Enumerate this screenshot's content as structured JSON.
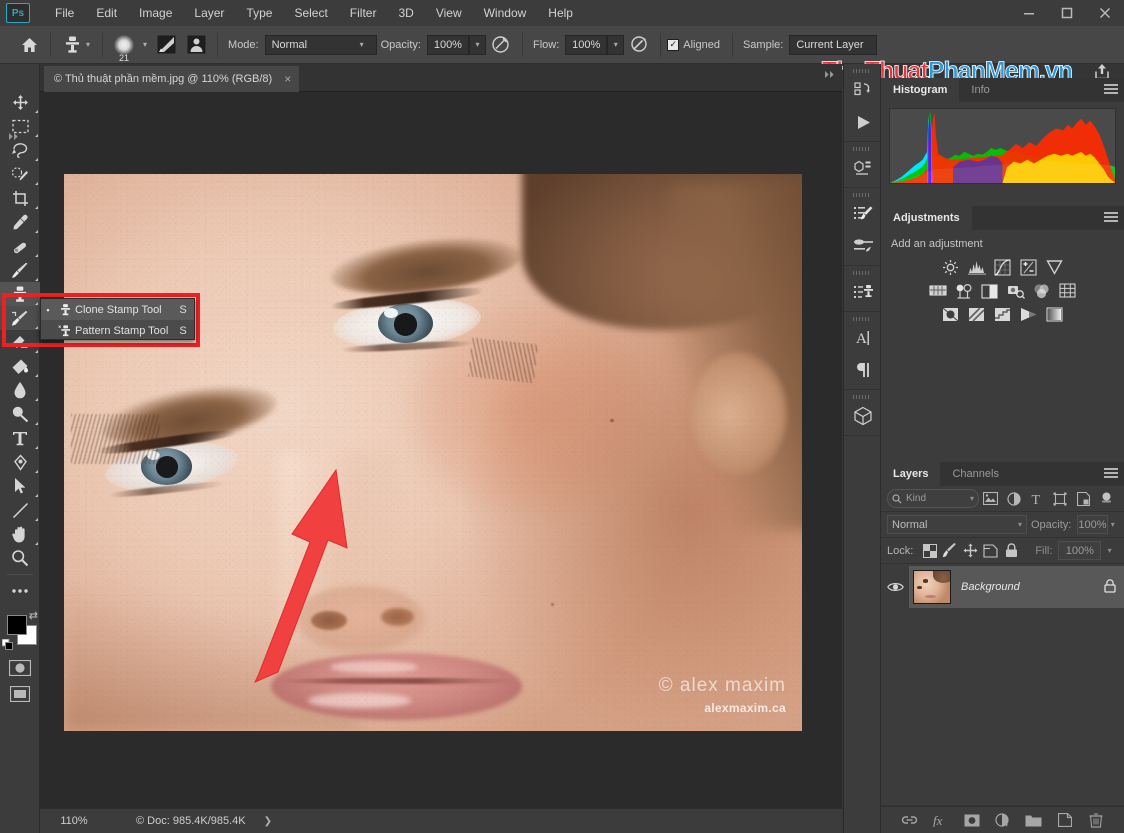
{
  "window": {
    "app_logo": "Ps",
    "controls": {
      "minimize": "minimize-icon",
      "maximize": "maximize-icon",
      "close": "close-icon"
    }
  },
  "menubar": {
    "items": [
      {
        "label": "File"
      },
      {
        "label": "Edit"
      },
      {
        "label": "Image"
      },
      {
        "label": "Layer"
      },
      {
        "label": "Type"
      },
      {
        "label": "Select"
      },
      {
        "label": "Filter"
      },
      {
        "label": "3D"
      },
      {
        "label": "View"
      },
      {
        "label": "Window"
      },
      {
        "label": "Help"
      }
    ]
  },
  "options_bar": {
    "home_icon": "home-icon",
    "tool_icon": "clone-stamp-icon",
    "brush_size": "21",
    "toggle_brush_panel": "brush-panel-icon",
    "toggle_clone_source": "clone-source-icon",
    "mode_label": "Mode:",
    "mode_value": "Normal",
    "opacity_label": "Opacity:",
    "opacity_value": "100%",
    "opacity_pressure_icon": "pressure-opacity-icon",
    "flow_label": "Flow:",
    "flow_value": "100%",
    "airbrush_icon": "airbrush-icon",
    "aligned_label": "Aligned",
    "aligned_checked": true,
    "sample_label": "Sample:",
    "sample_value": "Current Layer",
    "share_icon": "share-icon"
  },
  "watermark": {
    "parts": [
      {
        "text": "Thu",
        "color": "#e8353f"
      },
      {
        "text": "Thuat",
        "color": "#e8353f"
      },
      {
        "text": "Phan",
        "color": "#2d97d8"
      },
      {
        "text": "Mem",
        "color": "#2d97d8"
      },
      {
        "text": ".vn",
        "color": "#2d97d8"
      }
    ],
    "full": "ThuThuatPhanMem.vn",
    "red": "#e8353f",
    "blue": "#2d97d8"
  },
  "document_tab": {
    "title": "© Thủ thuật phần mềm.jpg @ 110% (RGB/8)",
    "close_icon": "close-icon"
  },
  "toolbar": {
    "tools": [
      {
        "name": "move-tool",
        "glyph": "move"
      },
      {
        "name": "rectangular-marquee-tool",
        "glyph": "marquee"
      },
      {
        "name": "lasso-tool",
        "glyph": "lasso"
      },
      {
        "name": "quick-selection-tool",
        "glyph": "quickselect"
      },
      {
        "name": "crop-tool",
        "glyph": "crop"
      },
      {
        "name": "eyedropper-tool",
        "glyph": "eyedropper"
      },
      {
        "name": "spot-healing-brush-tool",
        "glyph": "healing"
      },
      {
        "name": "brush-tool",
        "glyph": "brush"
      },
      {
        "name": "clone-stamp-tool",
        "glyph": "stamp",
        "selected": true
      },
      {
        "name": "history-brush-tool",
        "glyph": "historybrush"
      },
      {
        "name": "eraser-tool",
        "glyph": "eraser"
      },
      {
        "name": "gradient-tool",
        "glyph": "gradient"
      },
      {
        "name": "blur-tool",
        "glyph": "blur"
      },
      {
        "name": "dodge-tool",
        "glyph": "dodge"
      },
      {
        "name": "horizontal-type-tool",
        "glyph": "type"
      },
      {
        "name": "pen-tool",
        "glyph": "pen"
      },
      {
        "name": "path-selection-tool",
        "glyph": "pathselect"
      },
      {
        "name": "line-tool",
        "glyph": "line"
      },
      {
        "name": "hand-tool",
        "glyph": "hand"
      },
      {
        "name": "zoom-tool",
        "glyph": "zoom"
      },
      {
        "name": "edit-toolbar-tool",
        "glyph": "ellipsis"
      }
    ],
    "foreground_color": "#000000",
    "background_color": "#ffffff"
  },
  "tool_flyout": {
    "highlight_color": "#ed2024",
    "items": [
      {
        "label": "Clone Stamp Tool",
        "shortcut": "S",
        "selected": true,
        "icon": "clone-stamp-icon"
      },
      {
        "label": "Pattern Stamp Tool",
        "shortcut": "S",
        "selected": false,
        "icon": "pattern-stamp-icon"
      }
    ]
  },
  "annotation": {
    "arrow_color": "#f04040",
    "arrow_name": "red-pointer-arrow"
  },
  "canvas": {
    "image_signature": "© alex maxim",
    "image_url_text": "alexmaxim.ca",
    "zoom": "110%"
  },
  "status_bar": {
    "zoom": "110%",
    "doc_info": "© Doc: 985.4K/985.4K",
    "expand_icon": "chevron-right-icon"
  },
  "panel_strip": {
    "groups": [
      {
        "icons": [
          {
            "name": "history-icon"
          },
          {
            "name": "actions-play-icon"
          }
        ]
      },
      {
        "icons": [
          {
            "name": "3d-properties-icon"
          }
        ]
      },
      {
        "icons": [
          {
            "name": "brush-presets-icon"
          },
          {
            "name": "brush-settings-icon"
          }
        ]
      },
      {
        "icons": [
          {
            "name": "clone-source-icon"
          }
        ]
      },
      {
        "icons": [
          {
            "name": "character-icon"
          },
          {
            "name": "paragraph-icon"
          }
        ]
      },
      {
        "icons": [
          {
            "name": "3d-panel-icon"
          }
        ]
      }
    ]
  },
  "histogram_panel": {
    "tabs": [
      {
        "label": "Histogram",
        "active": true
      },
      {
        "label": "Info",
        "active": false
      }
    ],
    "menu_icon": "panel-menu-icon"
  },
  "adjustments_panel": {
    "tabs": [
      {
        "label": "Adjustments",
        "active": true
      }
    ],
    "menu_icon": "panel-menu-icon",
    "subtitle": "Add an adjustment",
    "rows": [
      [
        "brightness-contrast-icon",
        "levels-icon",
        "curves-icon",
        "exposure-icon",
        "vibrance-icon"
      ],
      [
        "hue-saturation-icon",
        "color-balance-icon",
        "black-white-icon",
        "photo-filter-icon",
        "channel-mixer-icon",
        "color-lookup-icon"
      ],
      [
        "invert-icon",
        "posterize-icon",
        "threshold-icon",
        "gradient-map-icon",
        "selective-color-icon"
      ]
    ]
  },
  "layers_panel": {
    "tabs": [
      {
        "label": "Layers",
        "active": true
      },
      {
        "label": "Channels",
        "active": false
      }
    ],
    "menu_icon": "panel-menu-icon",
    "filter": {
      "search_icon": "search-icon",
      "kind_label": "Kind",
      "filter_icons": [
        "filter-image-icon",
        "filter-adjustment-icon",
        "filter-type-icon",
        "filter-shape-icon",
        "filter-smart-icon"
      ],
      "toggle_icon": "filter-toggle-icon"
    },
    "blend_mode": "Normal",
    "opacity_label": "Opacity:",
    "opacity_value": "100%",
    "lock_label": "Lock:",
    "lock_icons": [
      "lock-transparency-icon",
      "lock-image-icon",
      "lock-position-icon",
      "lock-artboard-icon",
      "lock-all-icon"
    ],
    "fill_label": "Fill:",
    "fill_value": "100%",
    "layers": [
      {
        "name": "Background",
        "visible": true,
        "locked": true,
        "eye_icon": "eye-icon",
        "lock_icon": "lock-icon"
      }
    ],
    "bottom_icons": [
      "link-layers-icon",
      "layer-style-fx-icon",
      "layer-mask-icon",
      "new-adjustment-layer-icon",
      "new-group-icon",
      "new-layer-icon",
      "delete-layer-icon"
    ]
  }
}
